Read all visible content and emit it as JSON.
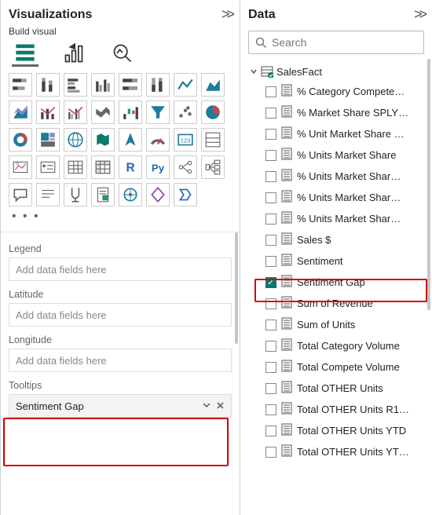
{
  "viz": {
    "title": "Visualizations",
    "subtitle": "Build visual",
    "more": "• • •",
    "wells": [
      {
        "label": "Legend",
        "value": null,
        "placeholder": "Add data fields here"
      },
      {
        "label": "Latitude",
        "value": null,
        "placeholder": "Add data fields here"
      },
      {
        "label": "Longitude",
        "value": null,
        "placeholder": "Add data fields here"
      },
      {
        "label": "Tooltips",
        "value": "Sentiment Gap",
        "placeholder": "Add data fields here"
      }
    ]
  },
  "data": {
    "title": "Data",
    "search_placeholder": "Search",
    "table": "SalesFact",
    "fields": [
      {
        "name": "% Category Compete…",
        "checked": false
      },
      {
        "name": "% Market Share SPLY…",
        "checked": false
      },
      {
        "name": "% Unit Market Share …",
        "checked": false
      },
      {
        "name": "% Units Market Share",
        "checked": false
      },
      {
        "name": "% Units Market Shar…",
        "checked": false
      },
      {
        "name": "% Units Market Shar…",
        "checked": false
      },
      {
        "name": "% Units Market Shar…",
        "checked": false
      },
      {
        "name": "Sales $",
        "checked": false
      },
      {
        "name": "Sentiment",
        "checked": false
      },
      {
        "name": "Sentiment Gap",
        "checked": true
      },
      {
        "name": "Sum of Revenue",
        "checked": false
      },
      {
        "name": "Sum of Units",
        "checked": false
      },
      {
        "name": "Total Category Volume",
        "checked": false
      },
      {
        "name": "Total Compete Volume",
        "checked": false
      },
      {
        "name": "Total OTHER Units",
        "checked": false
      },
      {
        "name": "Total OTHER Units R1…",
        "checked": false
      },
      {
        "name": "Total OTHER Units YTD",
        "checked": false
      },
      {
        "name": "Total OTHER Units YT…",
        "checked": false
      }
    ]
  }
}
